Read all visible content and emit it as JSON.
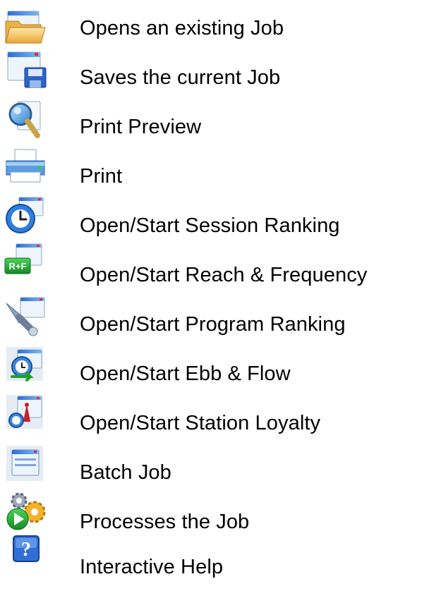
{
  "toolbar_legend": {
    "items": [
      {
        "icon": "open-folder-icon",
        "label": "Opens an existing Job"
      },
      {
        "icon": "save-icon",
        "label": "Saves the current Job"
      },
      {
        "icon": "print-preview-icon",
        "label": "Print Preview"
      },
      {
        "icon": "printer-icon",
        "label": "Print"
      },
      {
        "icon": "session-ranking-icon",
        "label": "Open/Start Session Ranking"
      },
      {
        "icon": "reach-frequency-icon",
        "label": "Open/Start Reach & Frequency"
      },
      {
        "icon": "program-ranking-icon",
        "label": "Open/Start Program Ranking"
      },
      {
        "icon": "ebb-flow-icon",
        "label": "Open/Start Ebb & Flow"
      },
      {
        "icon": "station-loyalty-icon",
        "label": "Open/Start Station Loyalty"
      },
      {
        "icon": "batch-job-icon",
        "label": "Batch Job"
      },
      {
        "icon": "process-job-icon",
        "label": "Processes the Job"
      },
      {
        "icon": "help-icon",
        "label": "Interactive Help"
      }
    ],
    "icon_text": {
      "reach_frequency": "R+F",
      "help": "?"
    }
  }
}
